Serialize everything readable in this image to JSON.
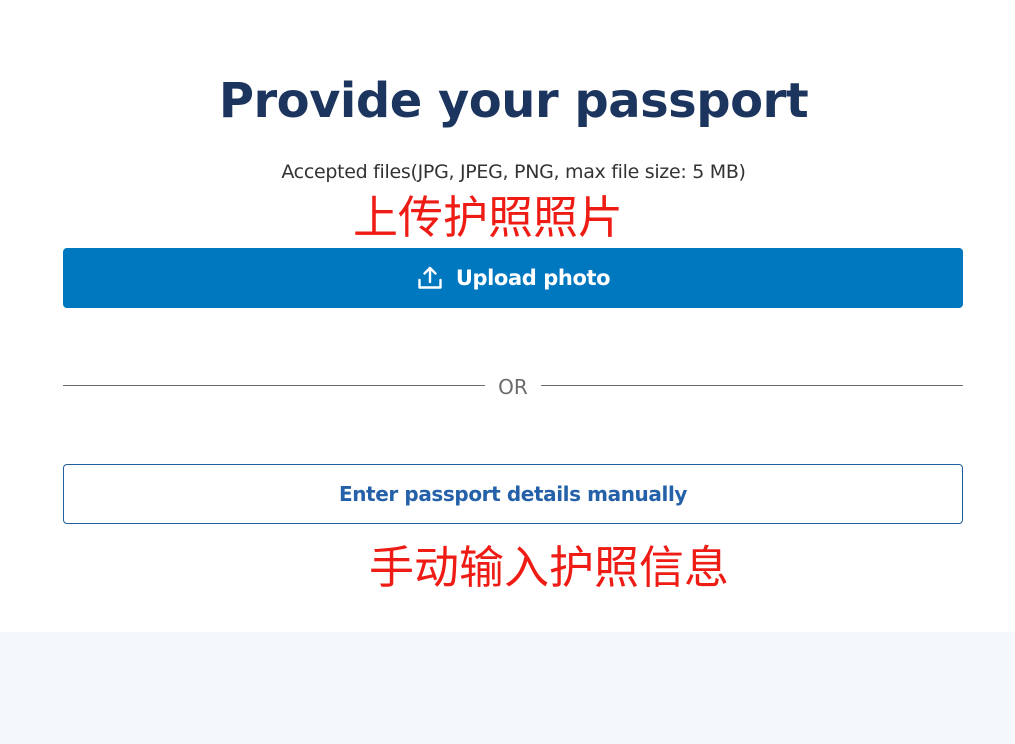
{
  "page": {
    "title": "Provide your passport",
    "subtitle": "Accepted files(JPG, JPEG, PNG, max file size: 5 MB)"
  },
  "annotations": {
    "upload_note": "上传护照照片",
    "manual_note": "手动输入护照信息"
  },
  "upload": {
    "label": "Upload photo",
    "icon": "upload-icon"
  },
  "divider": {
    "text": "OR"
  },
  "manual": {
    "label": "Enter passport details manually"
  },
  "colors": {
    "title": "#1c355e",
    "primary_button": "#0078c0",
    "manual_button_border": "#1f5f9e",
    "manual_button_text": "#2561a8",
    "annotation": "#ee1c14",
    "footer_band": "#f5f8fb"
  }
}
